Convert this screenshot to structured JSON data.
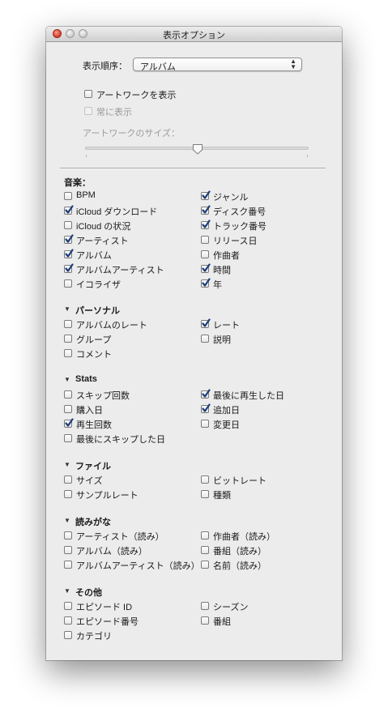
{
  "window": {
    "title": "表示オプション"
  },
  "sort": {
    "label": "表示順序：",
    "value": "アルバム"
  },
  "artwork": {
    "show": {
      "label": "アートワークを表示",
      "checked": false
    },
    "always": {
      "label": "常に表示",
      "checked": false,
      "enabled": false
    },
    "size_label": "アートワークのサイズ：",
    "size_level": 0.5
  },
  "music": {
    "title": "音楽：",
    "left": [
      {
        "label": "BPM",
        "checked": false
      },
      {
        "label": "iCloud ダウンロード",
        "checked": true
      },
      {
        "label": "iCloud の状況",
        "checked": false
      },
      {
        "label": "アーティスト",
        "checked": true
      },
      {
        "label": "アルバム",
        "checked": true
      },
      {
        "label": "アルバムアーティスト",
        "checked": true
      },
      {
        "label": "イコライザ",
        "checked": false
      }
    ],
    "right": [
      {
        "label": "ジャンル",
        "checked": true
      },
      {
        "label": "ディスク番号",
        "checked": true
      },
      {
        "label": "トラック番号",
        "checked": true
      },
      {
        "label": "リリース日",
        "checked": false
      },
      {
        "label": "作曲者",
        "checked": false
      },
      {
        "label": "時間",
        "checked": true
      },
      {
        "label": "年",
        "checked": true
      }
    ]
  },
  "personal": {
    "title": "パーソナル",
    "left": [
      {
        "label": "アルバムのレート",
        "checked": false
      },
      {
        "label": "グループ",
        "checked": false
      },
      {
        "label": "コメント",
        "checked": false
      }
    ],
    "right": [
      {
        "label": "レート",
        "checked": true
      },
      {
        "label": "説明",
        "checked": false
      }
    ]
  },
  "stats": {
    "title": "Stats",
    "left": [
      {
        "label": "スキップ回数",
        "checked": false
      },
      {
        "label": "購入日",
        "checked": false
      },
      {
        "label": "再生回数",
        "checked": true
      },
      {
        "label": "最後にスキップした日",
        "checked": false
      }
    ],
    "right": [
      {
        "label": "最後に再生した日",
        "checked": true
      },
      {
        "label": "追加日",
        "checked": true
      },
      {
        "label": "変更日",
        "checked": false
      }
    ]
  },
  "file": {
    "title": "ファイル",
    "left": [
      {
        "label": "サイズ",
        "checked": false
      },
      {
        "label": "サンプルレート",
        "checked": false
      }
    ],
    "right": [
      {
        "label": "ビットレート",
        "checked": false
      },
      {
        "label": "種類",
        "checked": false
      }
    ]
  },
  "reading": {
    "title": "読みがな",
    "left": [
      {
        "label": "アーティスト（読み）",
        "checked": false
      },
      {
        "label": "アルバム（読み）",
        "checked": false
      },
      {
        "label": "アルバムアーティスト（読み）",
        "checked": false
      }
    ],
    "right": [
      {
        "label": "作曲者（読み）",
        "checked": false
      },
      {
        "label": "番組（読み）",
        "checked": false
      },
      {
        "label": "名前（読み）",
        "checked": false
      }
    ]
  },
  "other": {
    "title": "その他",
    "left": [
      {
        "label": "エピソード ID",
        "checked": false
      },
      {
        "label": "エピソード番号",
        "checked": false
      },
      {
        "label": "カテゴリ",
        "checked": false
      }
    ],
    "right": [
      {
        "label": "シーズン",
        "checked": false
      },
      {
        "label": "番組",
        "checked": false
      }
    ]
  }
}
